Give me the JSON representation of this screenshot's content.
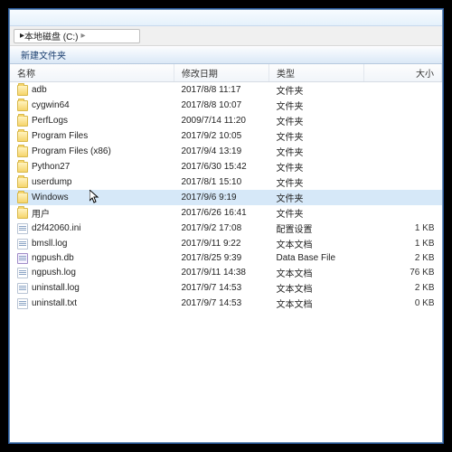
{
  "breadcrumb": {
    "sep": "▸",
    "drive": "本地磁盘 (C:)",
    "sep2": "▸"
  },
  "toolbar": {
    "newfolder": "新建文件夹"
  },
  "columns": {
    "name": "名称",
    "date": "修改日期",
    "type": "类型",
    "size": "大小"
  },
  "items": [
    {
      "icon": "folder",
      "name": "adb",
      "date": "2017/8/8 11:17",
      "type": "文件夹",
      "size": ""
    },
    {
      "icon": "folder",
      "name": "cygwin64",
      "date": "2017/8/8 10:07",
      "type": "文件夹",
      "size": ""
    },
    {
      "icon": "folder",
      "name": "PerfLogs",
      "date": "2009/7/14 11:20",
      "type": "文件夹",
      "size": ""
    },
    {
      "icon": "folder",
      "name": "Program Files",
      "date": "2017/9/2 10:05",
      "type": "文件夹",
      "size": ""
    },
    {
      "icon": "folder",
      "name": "Program Files (x86)",
      "date": "2017/9/4 13:19",
      "type": "文件夹",
      "size": ""
    },
    {
      "icon": "folder",
      "name": "Python27",
      "date": "2017/6/30 15:42",
      "type": "文件夹",
      "size": ""
    },
    {
      "icon": "folder",
      "name": "userdump",
      "date": "2017/8/1 15:10",
      "type": "文件夹",
      "size": ""
    },
    {
      "icon": "folder",
      "name": "Windows",
      "date": "2017/9/6 9:19",
      "type": "文件夹",
      "size": "",
      "selected": true
    },
    {
      "icon": "folder",
      "name": "用户",
      "date": "2017/6/26 16:41",
      "type": "文件夹",
      "size": ""
    },
    {
      "icon": "ini",
      "name": "d2f42060.ini",
      "date": "2017/9/2 17:08",
      "type": "配置设置",
      "size": "1 KB"
    },
    {
      "icon": "log",
      "name": "bmsll.log",
      "date": "2017/9/11 9:22",
      "type": "文本文档",
      "size": "1 KB"
    },
    {
      "icon": "db",
      "name": "ngpush.db",
      "date": "2017/8/25 9:39",
      "type": "Data Base File",
      "size": "2 KB"
    },
    {
      "icon": "log",
      "name": "ngpush.log",
      "date": "2017/9/11 14:38",
      "type": "文本文档",
      "size": "76 KB"
    },
    {
      "icon": "log",
      "name": "uninstall.log",
      "date": "2017/9/7 14:53",
      "type": "文本文档",
      "size": "2 KB"
    },
    {
      "icon": "txt",
      "name": "uninstall.txt",
      "date": "2017/9/7 14:53",
      "type": "文本文档",
      "size": "0 KB"
    }
  ]
}
